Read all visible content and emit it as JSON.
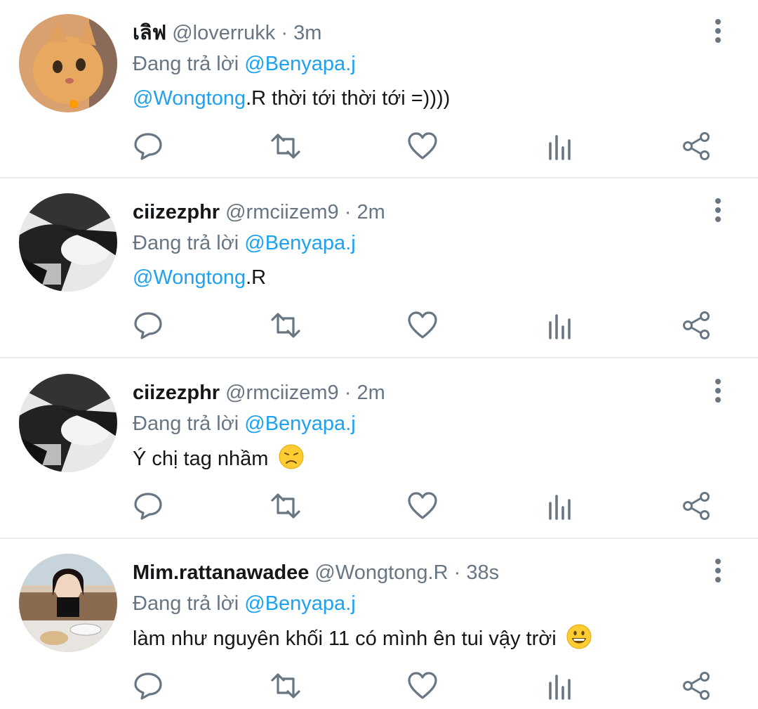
{
  "replying_label": "Đang trả lời",
  "colors": {
    "accent": "#1da1f2",
    "secondary": "#687684",
    "primary_text": "#14171a",
    "icon": "#687684"
  },
  "tweets": [
    {
      "name": "เลิฟ",
      "handle": "@loverrukk",
      "sep": " · ",
      "time": "3m",
      "reply_to": "@Benyapa.j",
      "mention": "@Wongtong",
      "text": ".R thời tới thời tới =))))",
      "avatar": "cat-avatar"
    },
    {
      "name": "ciizezphr",
      "handle": "@rmciizem9",
      "sep": " · ",
      "time": "2m",
      "reply_to": "@Benyapa.j",
      "mention": "@Wongtong",
      "text": ".R",
      "avatar": "bw-avatar"
    },
    {
      "name": "ciizezphr",
      "handle": "@rmciizem9",
      "sep": " · ",
      "time": "2m",
      "reply_to": "@Benyapa.j",
      "mention": "",
      "text": "Ý chị tag nhầm",
      "emoji": "disappointed-face-emoji",
      "avatar": "bw-avatar"
    },
    {
      "name": "Mim.rattanawadee",
      "handle": "@Wongtong.R",
      "sep": " · ",
      "time": "38s",
      "reply_to": "@Benyapa.j",
      "mention": "",
      "text": "làm như nguyên khối 11 có mình ên tui vậy trời",
      "emoji": "grinning-face-emoji",
      "avatar": "photo-avatar"
    }
  ],
  "action_icons": [
    "reply-icon",
    "retweet-icon",
    "like-icon",
    "analytics-icon",
    "share-icon"
  ]
}
